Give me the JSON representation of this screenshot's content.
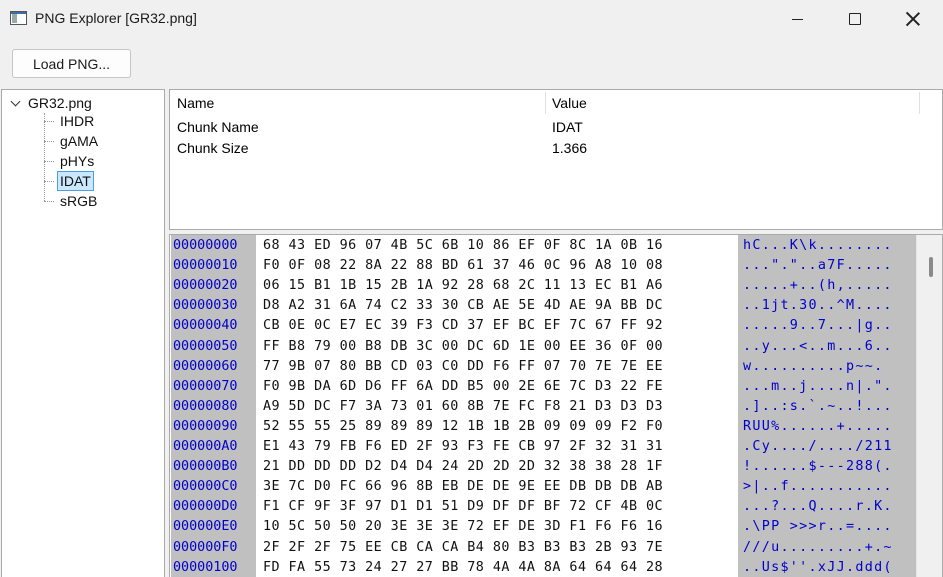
{
  "window": {
    "title": "PNG Explorer [GR32.png]",
    "icon": "app-window-icon",
    "minimize_icon": "minimize-icon",
    "maximize_icon": "maximize-icon",
    "close_icon": "close-icon"
  },
  "toolbar": {
    "load_label": "Load PNG..."
  },
  "tree": {
    "root": "GR32.png",
    "expander_icon": "chevron-down-icon",
    "children": [
      "IHDR",
      "gAMA",
      "pHYs",
      "IDAT",
      "sRGB"
    ],
    "selected": "IDAT"
  },
  "properties": {
    "headers": {
      "name": "Name",
      "value": "Value"
    },
    "rows": [
      {
        "name": "Chunk Name",
        "value": "IDAT"
      },
      {
        "name": "Chunk Size",
        "value": "1.366"
      }
    ]
  },
  "hex": {
    "rows": [
      {
        "addr": "00000000",
        "bytes": "68 43 ED 96 07 4B 5C 6B 10 86 EF 0F 8C 1A 0B 16",
        "ascii": "hC...K\\k........"
      },
      {
        "addr": "00000010",
        "bytes": "F0 0F 08 22 8A 22 88 BD 61 37 46 0C 96 A8 10 08",
        "ascii": "...\".\"..a7F....."
      },
      {
        "addr": "00000020",
        "bytes": "06 15 B1 1B 15 2B 1A 92 28 68 2C 11 13 EC B1 A6",
        "ascii": ".....+..(h,....."
      },
      {
        "addr": "00000030",
        "bytes": "D8 A2 31 6A 74 C2 33 30 CB AE 5E 4D AE 9A BB DC",
        "ascii": "..1jt.30..^M...."
      },
      {
        "addr": "00000040",
        "bytes": "CB 0E 0C E7 EC 39 F3 CD 37 EF BC EF 7C 67 FF 92",
        "ascii": ".....9..7...|g.."
      },
      {
        "addr": "00000050",
        "bytes": "FF B8 79 00 B8 DB 3C 00 DC 6D 1E 00 EE 36 0F 00",
        "ascii": "..y...<..m...6.."
      },
      {
        "addr": "00000060",
        "bytes": "77 9B 07 80 BB CD 03 C0 DD F6 FF 07 70 7E 7E EE",
        "ascii": "w..........p~~."
      },
      {
        "addr": "00000070",
        "bytes": "F0 9B DA 6D D6 FF 6A DD B5 00 2E 6E 7C D3 22 FE",
        "ascii": "...m..j....n|.\"."
      },
      {
        "addr": "00000080",
        "bytes": "A9 5D DC F7 3A 73 01 60 8B 7E FC F8 21 D3 D3 D3",
        "ascii": ".]..:s.`.~..!..."
      },
      {
        "addr": "00000090",
        "bytes": "52 55 55 25 89 89 89 12 1B 1B 2B 09 09 09 F2 F0",
        "ascii": "RUU%......+....."
      },
      {
        "addr": "000000A0",
        "bytes": "E1 43 79 FB F6 ED 2F 93 F3 FE CB 97 2F 32 31 31",
        "ascii": ".Cy..../..../211"
      },
      {
        "addr": "000000B0",
        "bytes": "21 DD DD DD D2 D4 D4 24 2D 2D 2D 32 38 38 28 1F",
        "ascii": "!......$---288(."
      },
      {
        "addr": "000000C0",
        "bytes": "3E 7C D0 FC 66 96 8B EB DE DE 9E EE DB DB DB AB",
        "ascii": ">|..f..........."
      },
      {
        "addr": "000000D0",
        "bytes": "F1 CF 9F 3F 97 D1 D1 51 D9 DF DF BF 72 CF 4B 0C",
        "ascii": "...?...Q....r.K."
      },
      {
        "addr": "000000E0",
        "bytes": "10 5C 50 50 20 3E 3E 3E 72 EF DE 3D F1 F6 F6 16",
        "ascii": ".\\PP >>>r..=...."
      },
      {
        "addr": "000000F0",
        "bytes": "2F 2F 2F 75 EE CB CA CA B4 80 B3 B3 B3 2B 93 7E",
        "ascii": "///u.........+.~"
      },
      {
        "addr": "00000100",
        "bytes": "FD FA 55 73 24 27 27 BB 78 4A 4A 8A 64 64 64 28",
        "ascii": "..Us$''.xJJ.ddd("
      }
    ]
  }
}
